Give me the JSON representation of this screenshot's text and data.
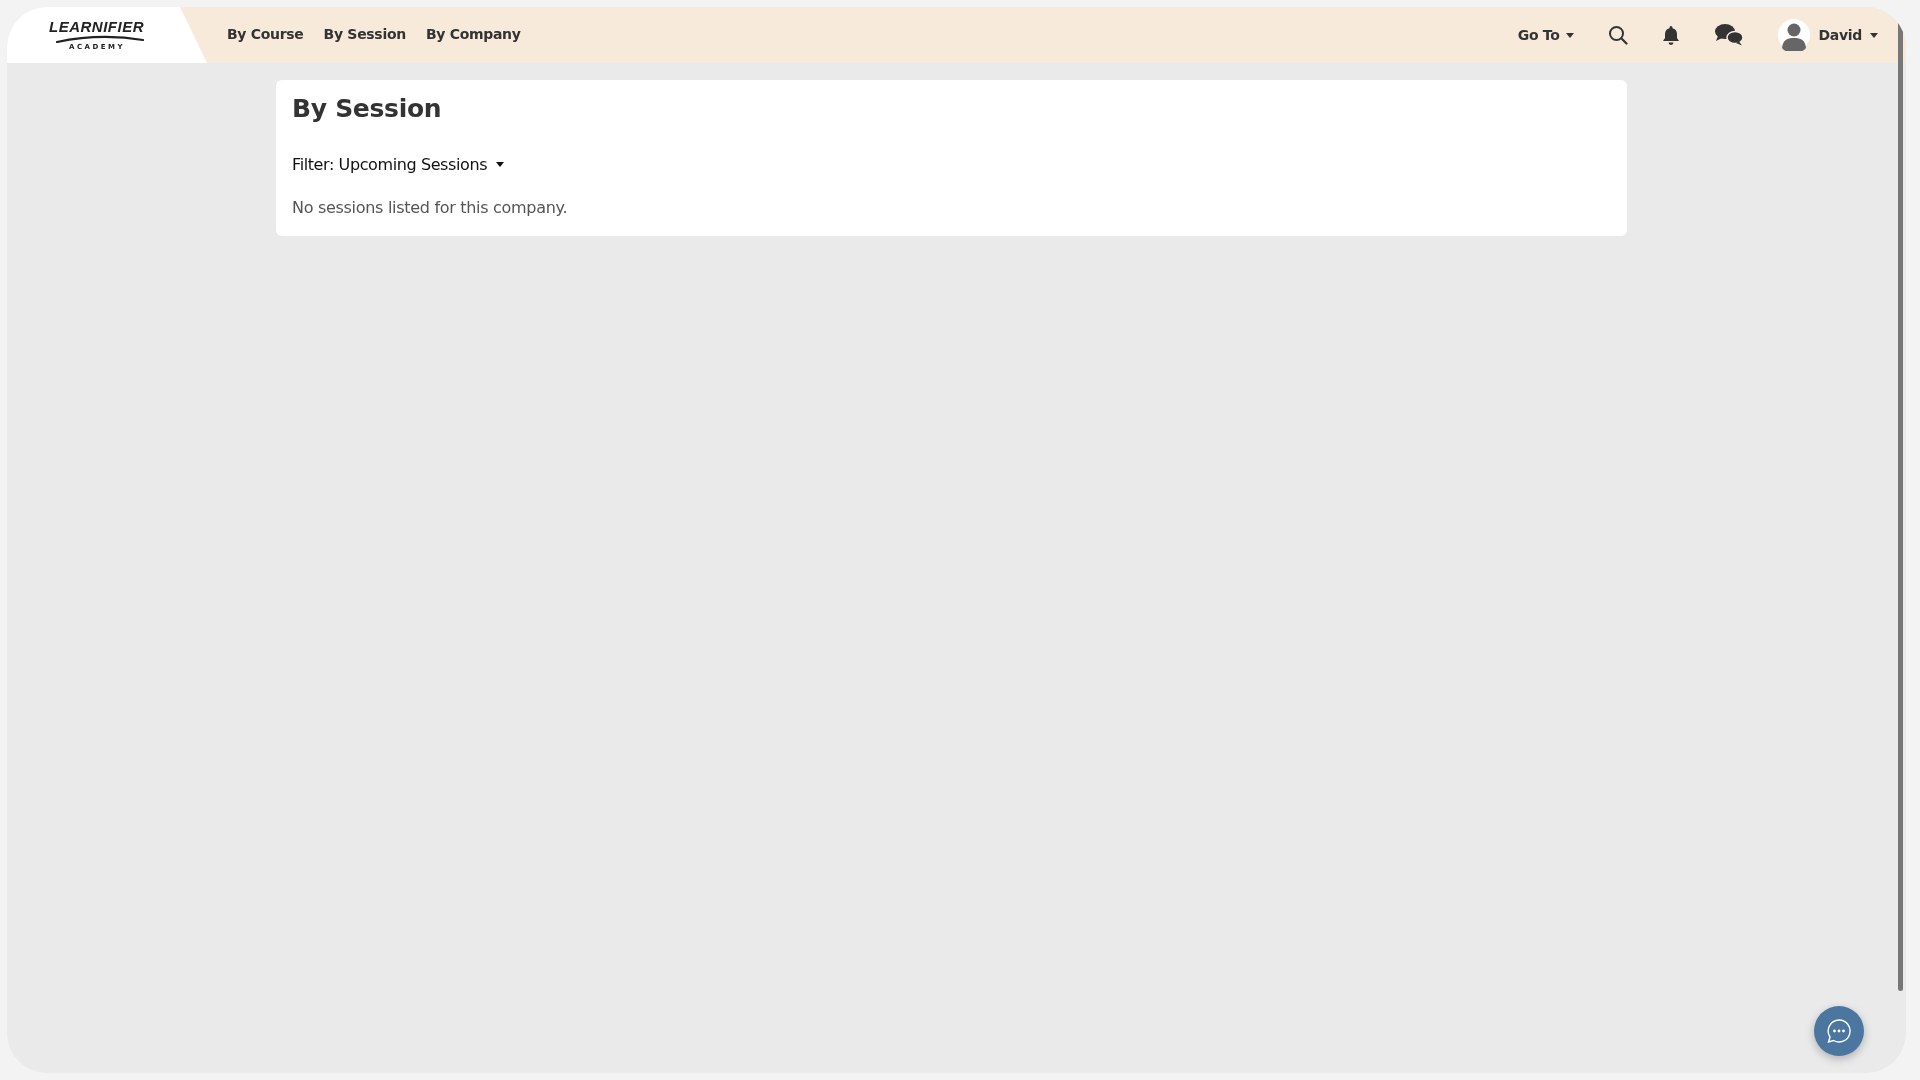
{
  "logo": {
    "name": "LEARNIFIER",
    "tagline": "ACADEMY"
  },
  "nav": [
    {
      "label": "By Course",
      "selected": false
    },
    {
      "label": "By Session",
      "selected": false
    },
    {
      "label": "By Company",
      "selected": false
    }
  ],
  "goto": {
    "label": "Go To"
  },
  "user": {
    "name": "David"
  },
  "card": {
    "title": "By Session",
    "filter": "Filter: Upcoming Sessions",
    "empty_message": "No sessions listed for this company."
  }
}
